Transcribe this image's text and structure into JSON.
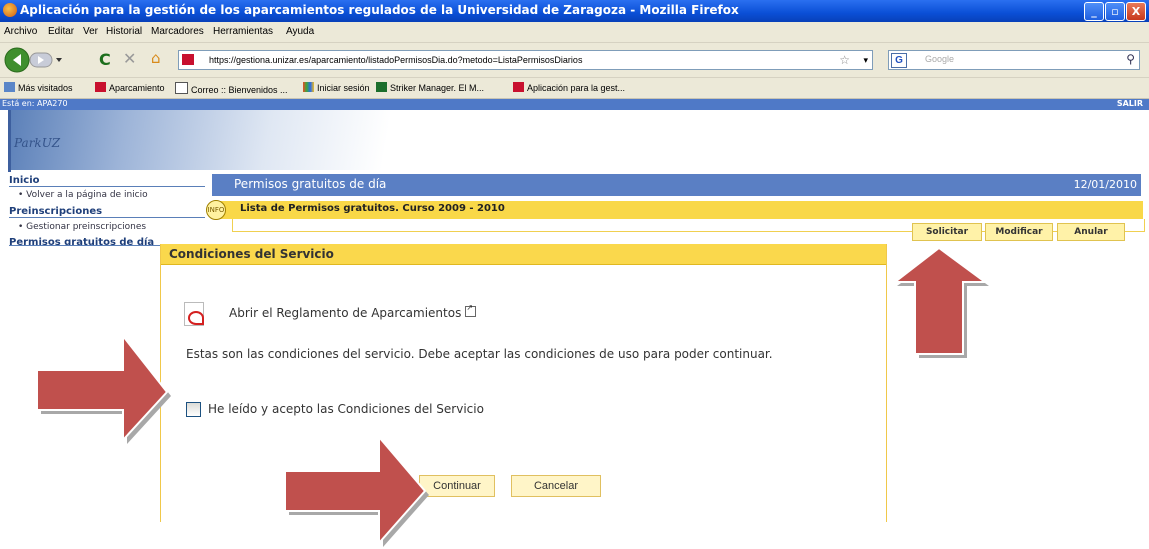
{
  "window": {
    "title": "Aplicación para la gestión de los aparcamientos regulados de la Universidad de Zaragoza - Mozilla Firefox",
    "buttons": [
      "_",
      "▫",
      "X"
    ]
  },
  "menu": [
    "Archivo",
    "Editar",
    "Ver",
    "Historial",
    "Marcadores",
    "Herramientas",
    "Ayuda"
  ],
  "nav": {
    "url": "https://gestiona.unizar.es/aparcamiento/listadoPermisosDia.do?metodo=ListaPermisosDiarios",
    "search_placeholder": "Google",
    "search_engine": "G"
  },
  "bookmarks": [
    "Más visitados",
    "Aparcamiento",
    "Correo :: Bienvenidos ...",
    "Iniciar sesión",
    "Striker Manager. El M...",
    "Aplicación para la gest..."
  ],
  "app": {
    "user": "Está en: APA270",
    "logout": "SALIR",
    "logo": "ParkUZ"
  },
  "sidebar": {
    "sections": [
      {
        "title": "Inicio",
        "item": "Volver a la página de inicio"
      },
      {
        "title": "Preinscripciones",
        "item": "Gestionar preinscripciones"
      },
      {
        "title": "Permisos gratuitos de día"
      }
    ]
  },
  "main": {
    "title": "Permisos gratuitos de día",
    "date": "12/01/2010",
    "list_title": "Lista de Permisos gratuitos. Curso 2009 - 2010",
    "info_icon": "INFO",
    "actions": [
      "Solicitar",
      "Modificar",
      "Anular"
    ]
  },
  "dialog": {
    "title": "Condiciones del Servicio",
    "link": "Abrir el Reglamento de Aparcamientos",
    "text": "Estas son las condiciones del servicio. Debe aceptar las condiciones de uso para poder continuar.",
    "checkbox_label": "He leído y acepto las Condiciones del Servicio",
    "checkbox_checked": false,
    "continue": "Continuar",
    "cancel": "Cancelar"
  },
  "colors": {
    "titlebar": "#0a4fd6",
    "app_blue": "#5a7fc4",
    "yellow": "#fad84c",
    "arrow": "#c0504d"
  }
}
